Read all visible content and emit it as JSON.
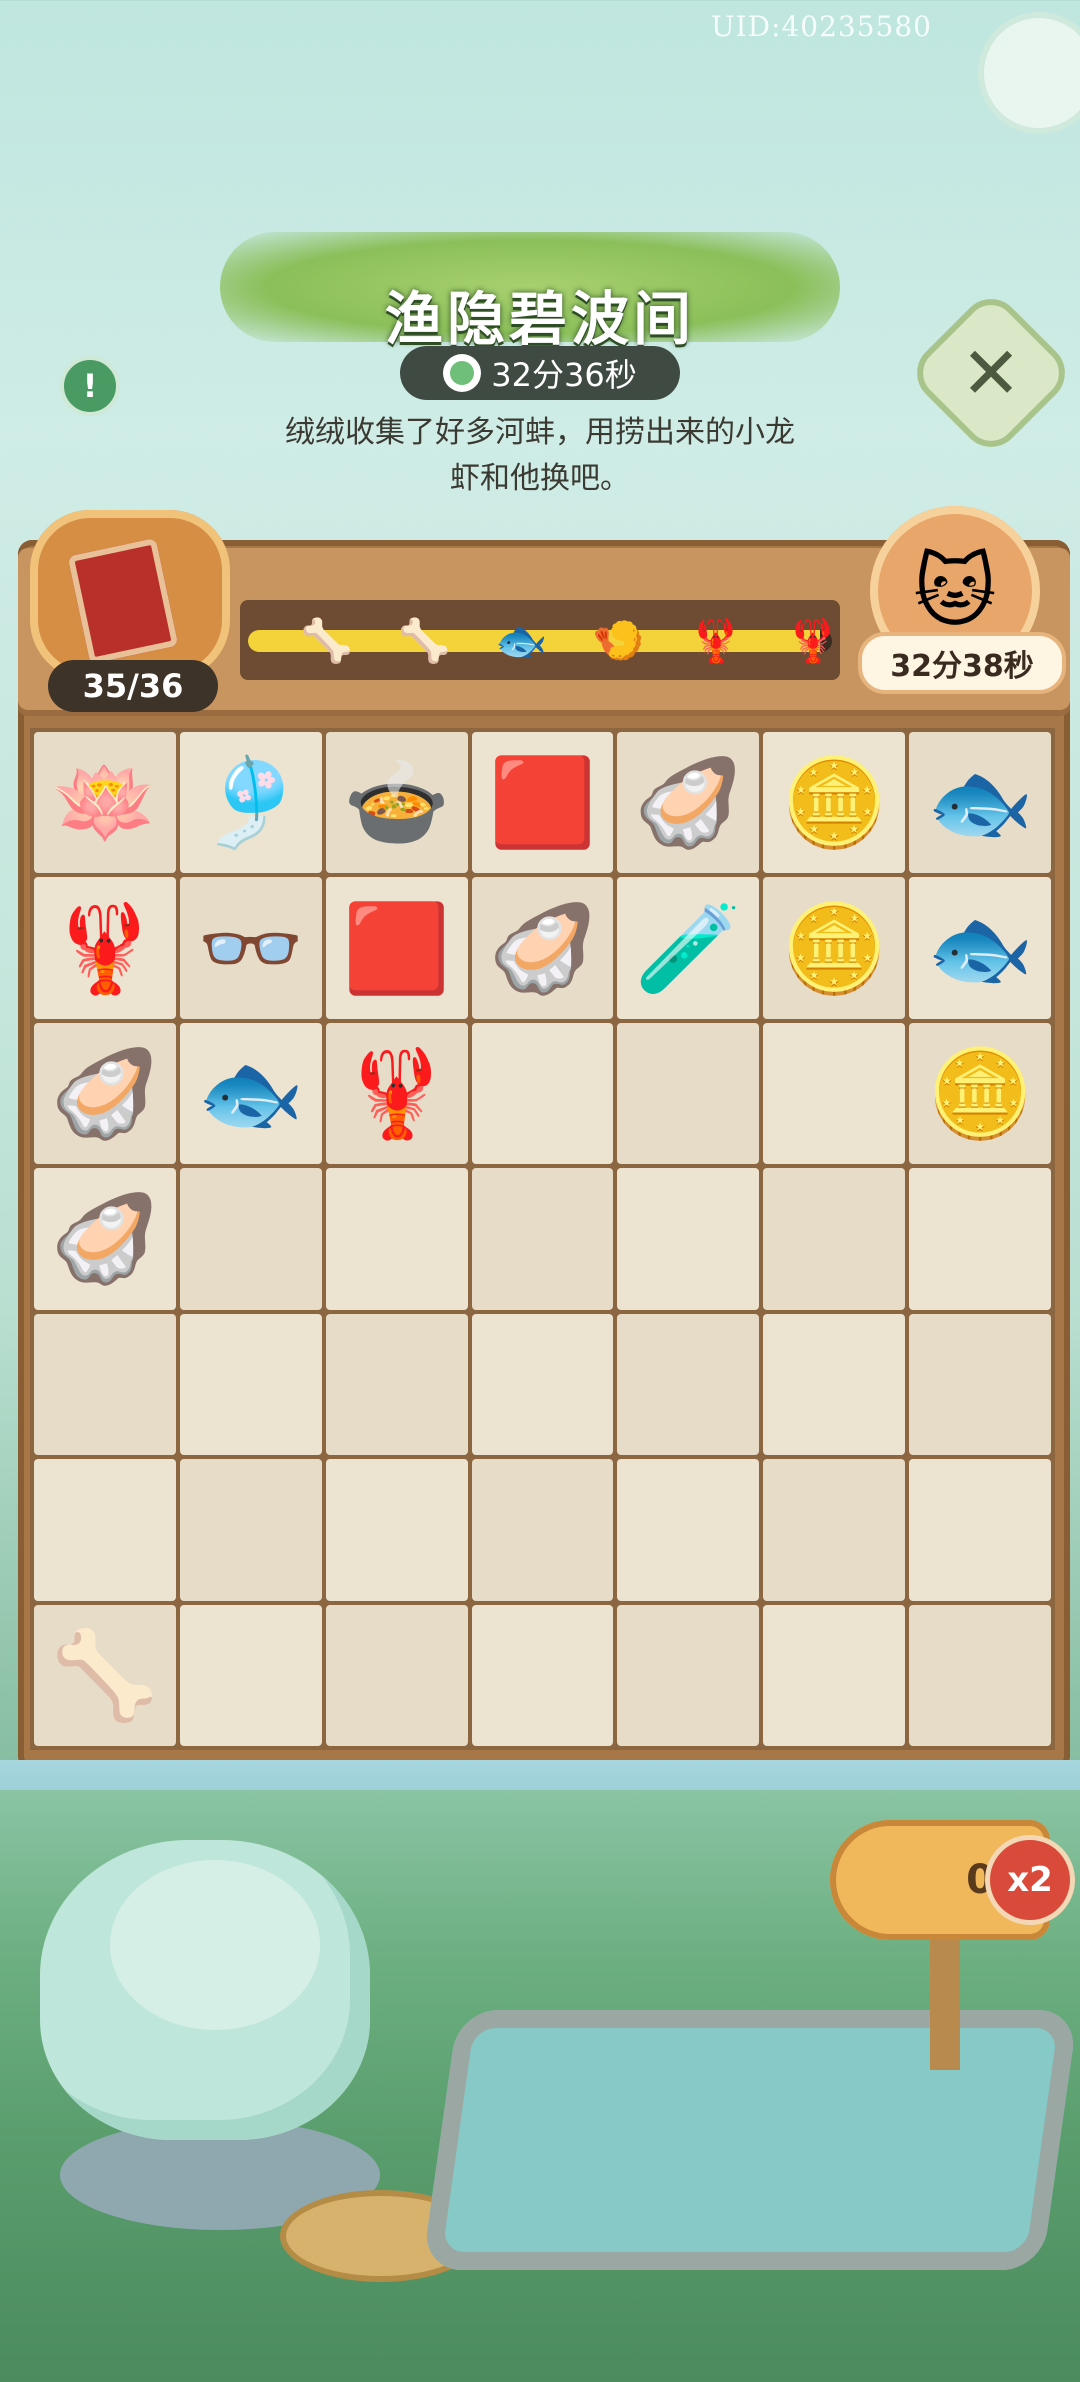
{
  "header": {
    "uid": "UID:40235580",
    "title": "渔隐碧波间",
    "timer": "32分36秒",
    "description_line1": "绒绒收集了好多河蚌，用捞出来的小龙",
    "description_line2": "虾和他换吧。"
  },
  "progress": {
    "count": "35/36",
    "fill_fraction": 0.98,
    "items": [
      "bone-icon",
      "bone-icon",
      "fish-icon",
      "shrimp-icon",
      "crayfish-icon",
      "crayfish-icon"
    ],
    "cat_timer": "32分38秒"
  },
  "grid": {
    "rows": [
      [
        "🪷",
        "🎐",
        "🍲",
        "🟥",
        "🦪",
        "🪙",
        "🐟"
      ],
      [
        "🦞",
        "👓",
        "🟥",
        "🦪",
        "🧪",
        "🪙",
        "🐟"
      ],
      [
        "🦪",
        "🐟",
        "🦞",
        "",
        "",
        "",
        "🪙"
      ],
      [
        "🦪",
        "",
        "",
        "",
        "",
        "",
        ""
      ],
      [
        "",
        "",
        "",
        "",
        "",
        "",
        ""
      ],
      [
        "",
        "",
        "",
        "",
        "",
        "",
        ""
      ],
      [
        "🦴",
        "",
        "",
        "",
        "",
        "",
        ""
      ]
    ],
    "names": [
      [
        "pearl-brooch-icon",
        "pearl-earring-icon",
        "fish-stew-icon",
        "ruby-icon",
        "pearl-clam-icon",
        "coins-icon",
        "grilled-fish-icon"
      ],
      [
        "crayfish-icon",
        "pearl-earrings-pair-icon",
        "rubies-icon",
        "pearl-clam-icon",
        "potion-sack-icon",
        "coin-icon",
        "grilled-fish-icon"
      ],
      [
        "clam-icon",
        "carp-icon",
        "crayfish-bowl-icon",
        "empty-cell",
        "empty-cell",
        "empty-cell",
        "coins-icon"
      ],
      [
        "clam-icon",
        "empty-cell",
        "empty-cell",
        "empty-cell",
        "empty-cell",
        "empty-cell",
        "empty-cell"
      ],
      [
        "empty-cell",
        "empty-cell",
        "empty-cell",
        "empty-cell",
        "empty-cell",
        "empty-cell",
        "empty-cell"
      ],
      [
        "empty-cell",
        "empty-cell",
        "empty-cell",
        "empty-cell",
        "empty-cell",
        "empty-cell",
        "empty-cell"
      ],
      [
        "fish-bone-icon",
        "empty-cell",
        "empty-cell",
        "empty-cell",
        "empty-cell",
        "empty-cell",
        "empty-cell"
      ]
    ]
  },
  "bottom": {
    "fish_count": "0",
    "multiplier": "x2"
  }
}
